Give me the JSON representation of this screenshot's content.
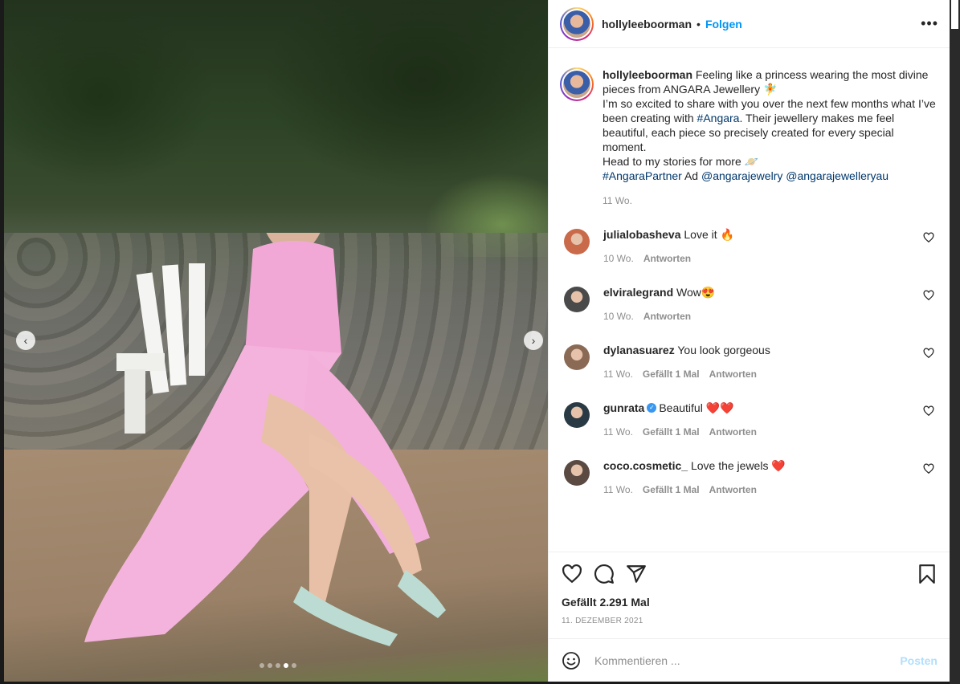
{
  "post": {
    "author": "hollyleeboorman",
    "follow_label": "Folgen",
    "more_label": "•••",
    "dot": "•"
  },
  "caption": {
    "username": "hollyleeboorman",
    "lines": [
      " Feeling like a princess wearing the most divine pieces from ANGARA Jewellery 🧚",
      "I’m so excited to share with you over the next few months what I’ve been creating with ",
      ". Their jewellery makes me feel beautiful, each piece so precisely created for every special moment.",
      "Head to my stories for more 🪐",
      " Ad "
    ],
    "tags": {
      "angara": "#Angara",
      "angara_partner": "#AngaraPartner",
      "mention1": "@angarajewelry",
      "mention2": "@angarajewelleryau"
    },
    "time": "11 Wo."
  },
  "comments": [
    {
      "username": "julialobasheva",
      "text": "Love it 🔥",
      "time": "10 Wo.",
      "likes": "",
      "reply": "Antworten",
      "avatar_color": "#c96a4a"
    },
    {
      "username": "elviralegrand",
      "text": "Wow😍",
      "time": "10 Wo.",
      "likes": "",
      "reply": "Antworten",
      "avatar_color": "#4a4a4a"
    },
    {
      "username": "dylanasuarez",
      "text": "You look gorgeous",
      "time": "11 Wo.",
      "likes": "Gefällt 1 Mal",
      "reply": "Antworten",
      "avatar_color": "#8a6a55"
    },
    {
      "username": "gunrata",
      "text": "Beautiful ❤️❤️",
      "time": "11 Wo.",
      "likes": "Gefällt 1 Mal",
      "reply": "Antworten",
      "avatar_color": "#2a3a44",
      "verified": true
    },
    {
      "username": "coco.cosmetic_",
      "text": "Love the jewels ❤️",
      "time": "11 Wo.",
      "likes": "Gefällt 1 Mal",
      "reply": "Antworten",
      "avatar_color": "#5a4a42"
    }
  ],
  "actions": {
    "likes": "Gefällt 2.291 Mal",
    "date": "11. DEZEMBER 2021"
  },
  "add_comment": {
    "placeholder": "Kommentieren ...",
    "post_label": "Posten"
  },
  "carousel": {
    "prev": "‹",
    "next": "›",
    "dots": 5,
    "active_dot": 3
  }
}
